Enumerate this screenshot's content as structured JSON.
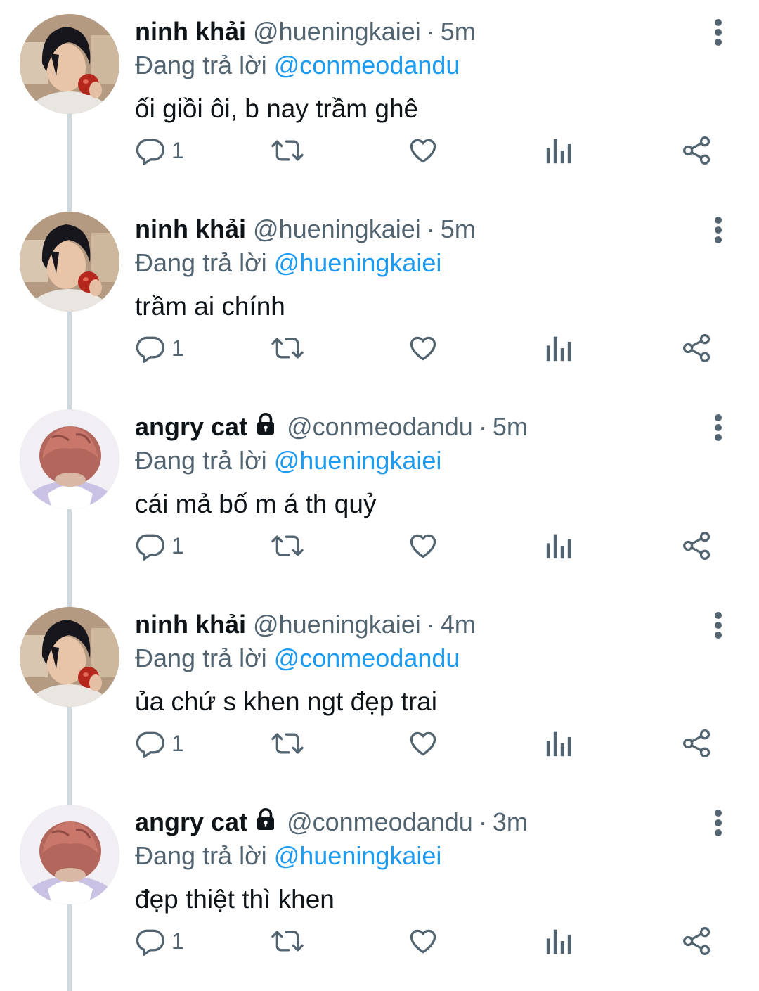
{
  "labels": {
    "replying_prefix": "Đang trả lời"
  },
  "colors": {
    "text": "#0f1419",
    "muted": "#536471",
    "link": "#1d9bf0",
    "thread_line": "#cfd9de"
  },
  "icons": {
    "reply": "reply-icon",
    "retweet": "retweet-icon",
    "like": "heart-icon",
    "views": "analytics-icon",
    "share": "share-icon",
    "more": "more-vertical-icon",
    "lock": "lock-icon"
  },
  "tweets": [
    {
      "name": "ninh khải",
      "handle": "@hueningkaiei",
      "time": "5m",
      "replying_to": "@conmeodandu",
      "text": "ối giồi ôi, b nay trầm ghê",
      "reply_count": "1",
      "avatar": "dark-hair-apple",
      "locked": false
    },
    {
      "name": "ninh khải",
      "handle": "@hueningkaiei",
      "time": "5m",
      "replying_to": "@hueningkaiei",
      "text": "trầm ai chính",
      "reply_count": "1",
      "avatar": "dark-hair-apple",
      "locked": false
    },
    {
      "name": "angry cat",
      "handle": "@conmeodandu",
      "time": "5m",
      "replying_to": "@hueningkaiei",
      "text": "cái mả bố m á th quỷ",
      "reply_count": "1",
      "avatar": "pink-hair",
      "locked": true
    },
    {
      "name": "ninh khải",
      "handle": "@hueningkaiei",
      "time": "4m",
      "replying_to": "@conmeodandu",
      "text": "ủa chứ s khen ngt đẹp trai",
      "reply_count": "1",
      "avatar": "dark-hair-apple",
      "locked": false
    },
    {
      "name": "angry cat",
      "handle": "@conmeodandu",
      "time": "3m",
      "replying_to": "@hueningkaiei",
      "text": "đẹp thiệt thì khen",
      "reply_count": "1",
      "avatar": "pink-hair",
      "locked": true
    }
  ]
}
